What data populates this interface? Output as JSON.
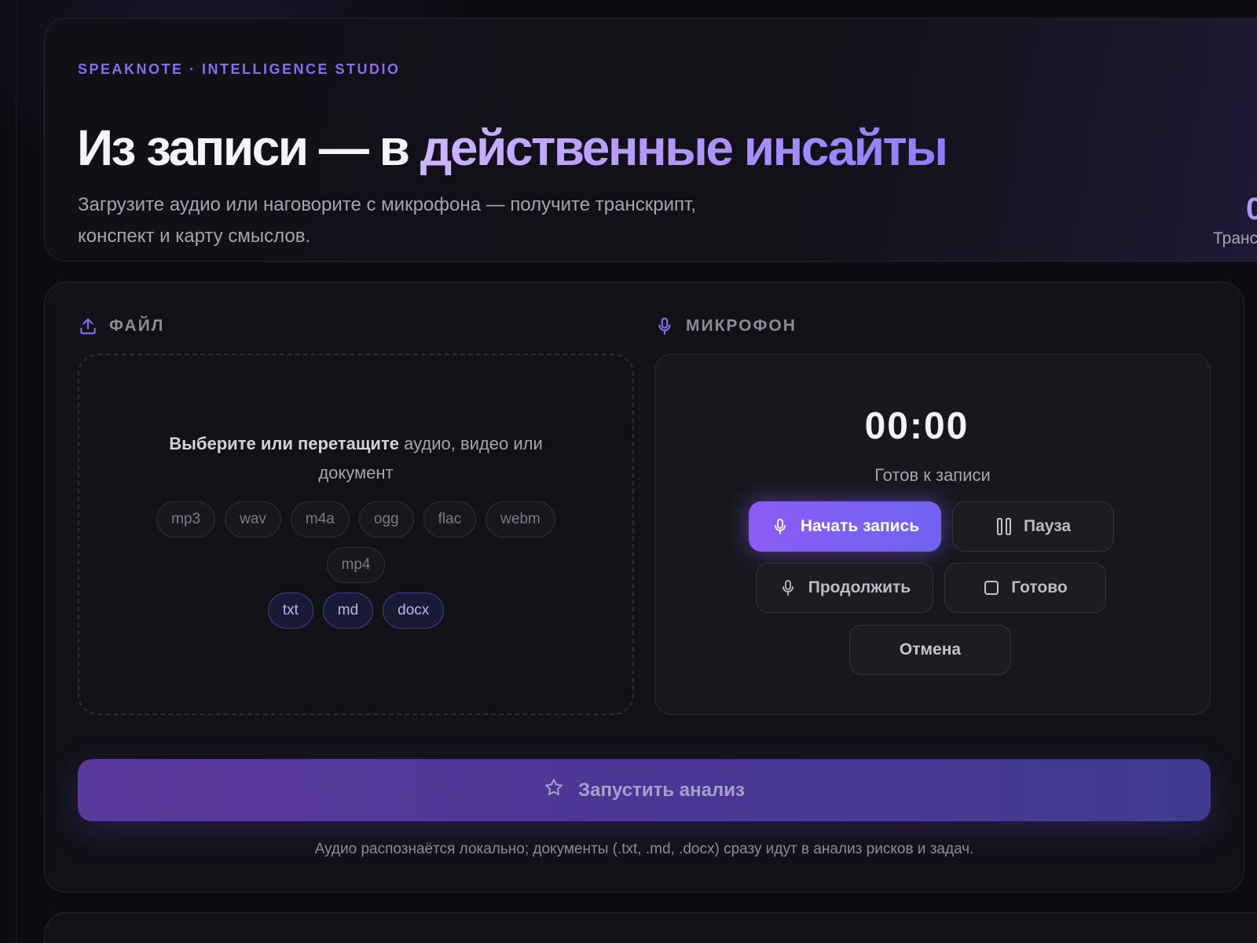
{
  "hero": {
    "eyebrow": "SPEAKNOTE · INTELLIGENCE STUDIO",
    "title_prefix": "Из записи — в ",
    "title_accent": "действенные инсайты",
    "subtitle_line1": "Загрузите аудио или наговорите с микрофона — получите транскрипт,",
    "subtitle_line2": "конспект и карту смыслов.",
    "stat_value": "0",
    "stat_label": "Транс"
  },
  "file_section": {
    "title": "ФАЙЛ",
    "icon": "upload-icon",
    "drop_bold": "Выберите или перетащите",
    "drop_rest": " аудио, видео или документ",
    "media_formats": [
      "mp3",
      "wav",
      "m4a",
      "ogg",
      "flac",
      "webm",
      "mp4"
    ],
    "doc_formats": [
      "txt",
      "md",
      "docx"
    ]
  },
  "mic_section": {
    "title": "МИКРОФОН",
    "icon": "microphone-icon",
    "timer": "00:00",
    "status": "Готов к записи",
    "buttons": {
      "start": "Начать запись",
      "pause": "Пауза",
      "continue": "Продолжить",
      "done": "Готово",
      "cancel": "Отмена"
    }
  },
  "analyze": {
    "label": "Запустить анализ",
    "icon": "star-icon",
    "footnote": "Аудио распознаётся локально; документы (.txt, .md, .docx) сразу идут в анализ рисков и задач."
  },
  "colors": {
    "background": "#0d0c12",
    "accent": "#8b6cf0",
    "primary_button": "#8a5cf5",
    "doc_chip": "#b9b6ee"
  }
}
